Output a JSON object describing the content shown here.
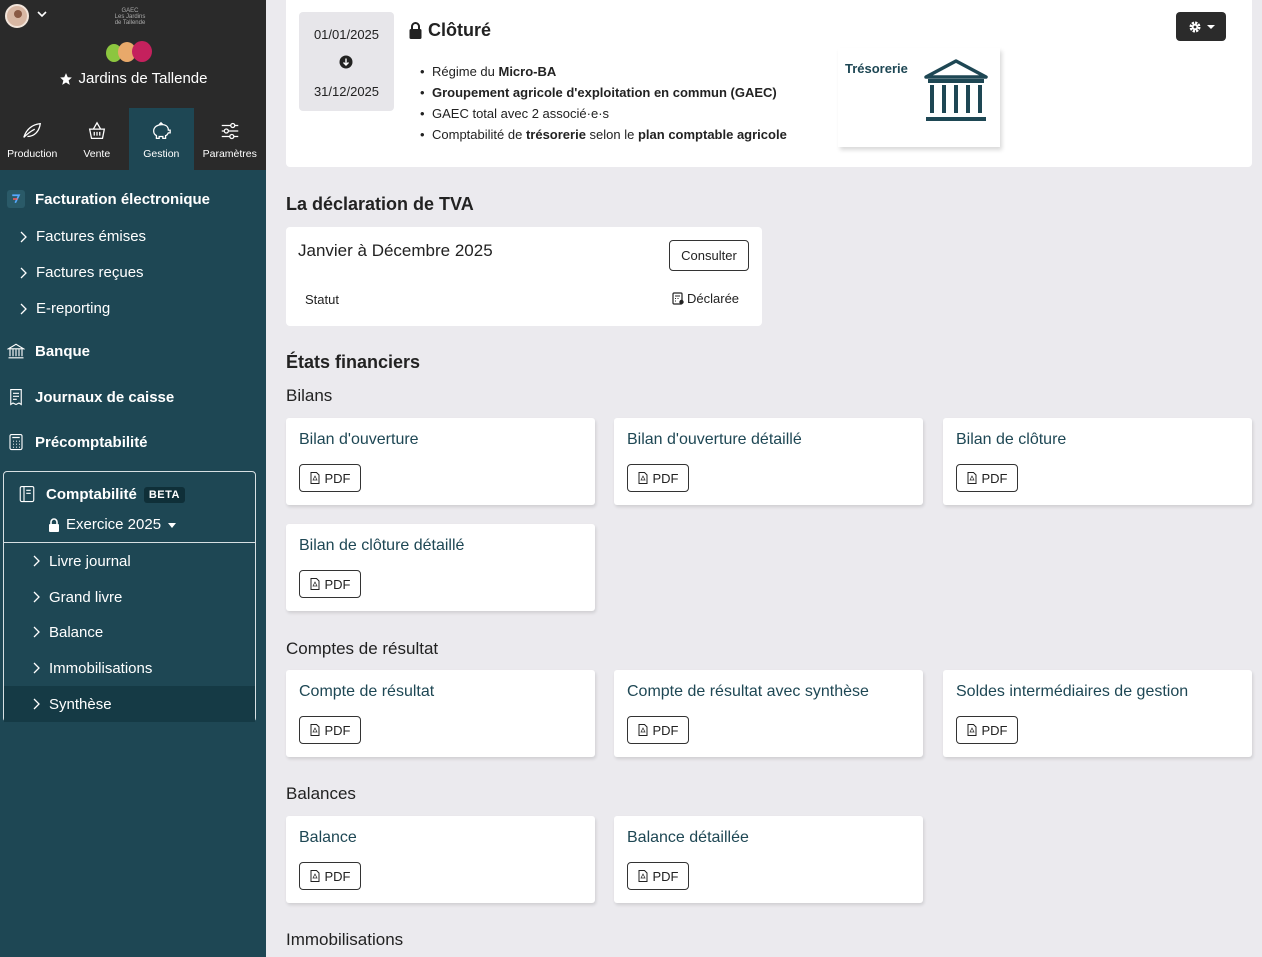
{
  "sidebar": {
    "farm_name": "Jardins de Tallende",
    "logo_text": [
      "GAEC",
      "Les Jardins",
      "de Tallende"
    ],
    "tabs": [
      {
        "label": "Production",
        "icon": "leaf-icon"
      },
      {
        "label": "Vente",
        "icon": "basket-icon"
      },
      {
        "label": "Gestion",
        "icon": "piggy-bank-icon"
      },
      {
        "label": "Paramètres",
        "icon": "sliders-icon"
      }
    ],
    "facturation": {
      "label": "Facturation électronique",
      "items": [
        "Factures émises",
        "Factures reçues",
        "E-reporting"
      ]
    },
    "banque": "Banque",
    "journaux": "Journaux de caisse",
    "precompta": "Précomptabilité",
    "compta": {
      "label": "Comptabilité",
      "badge": "BETA",
      "exercice": "Exercice 2025",
      "items": [
        "Livre journal",
        "Grand livre",
        "Balance",
        "Immobilisations",
        "Synthèse"
      ]
    }
  },
  "period": {
    "start": "01/01/2025",
    "end": "31/12/2025",
    "status": "Clôturé",
    "features": [
      {
        "prefix": "Régime du ",
        "bold": "Micro-BA",
        "middle": "",
        "bold2": "",
        "suffix": ""
      },
      {
        "prefix": "",
        "bold": "Groupement agricole d'exploitation en commun (GAEC)",
        "middle": "",
        "bold2": "",
        "suffix": ""
      },
      {
        "prefix": "GAEC total avec 2 associé·e·s",
        "bold": "",
        "middle": "",
        "bold2": "",
        "suffix": ""
      },
      {
        "prefix": "Comptabilité de ",
        "bold": "trésorerie",
        "middle": " selon le ",
        "bold2": "plan comptable agricole",
        "suffix": ""
      }
    ],
    "tresorerie_label": "Trésorerie"
  },
  "tva": {
    "heading": "La déclaration de TVA",
    "period": "Janvier à Décembre 2025",
    "consult": "Consulter",
    "status_label": "Statut",
    "status_value": "Déclarée"
  },
  "financial": {
    "heading": "États financiers",
    "pdf_label": "PDF",
    "groups": [
      {
        "label": "Bilans",
        "docs": [
          "Bilan d'ouverture",
          "Bilan d'ouverture détaillé",
          "Bilan de clôture",
          "Bilan de clôture détaillé"
        ]
      },
      {
        "label": "Comptes de résultat",
        "docs": [
          "Compte de résultat",
          "Compte de résultat avec synthèse",
          "Soldes intermédiaires de gestion"
        ]
      },
      {
        "label": "Balances",
        "docs": [
          "Balance",
          "Balance détaillée"
        ]
      },
      {
        "label": "Immobilisations",
        "docs": []
      }
    ]
  },
  "colors": {
    "sidebar_bg": "#1e4754",
    "sidebar_top_bg": "#2a2a2a",
    "main_bg": "#ebeaee",
    "accent": "#1e4754"
  }
}
